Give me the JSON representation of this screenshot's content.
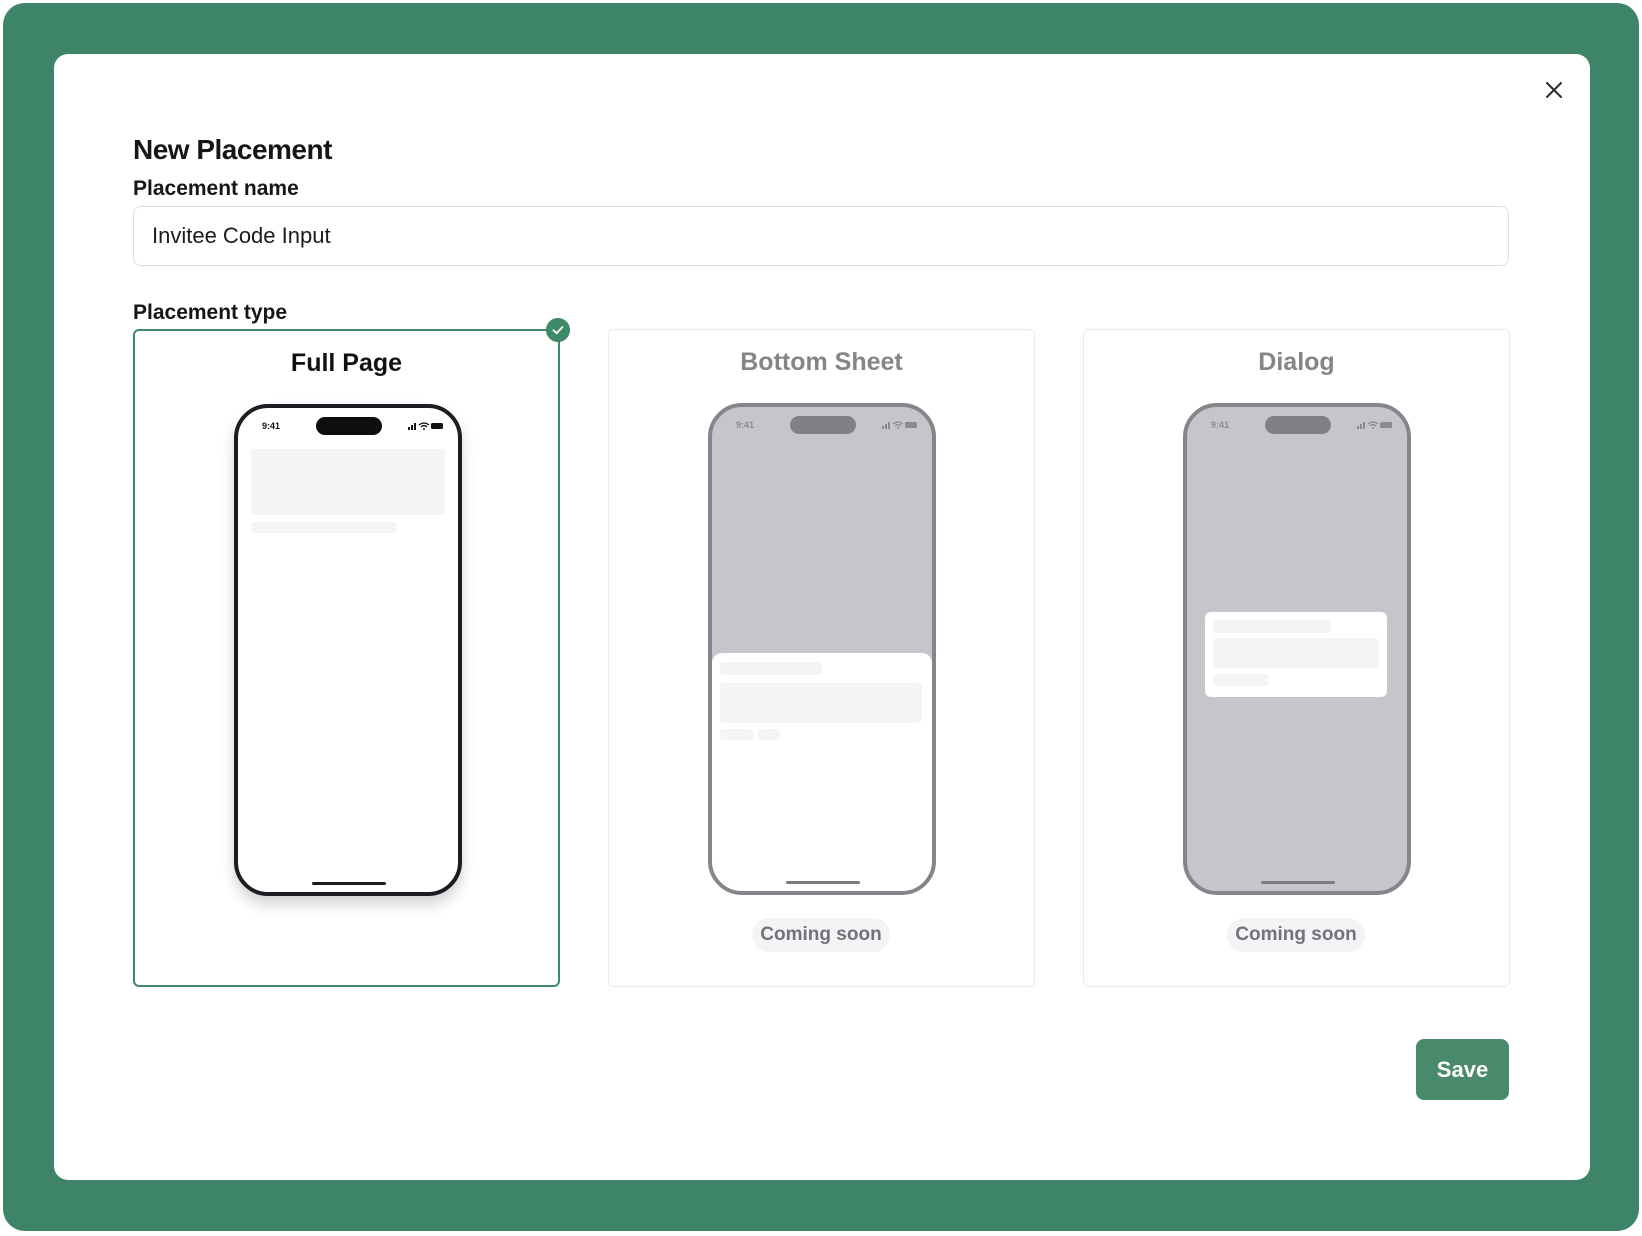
{
  "dialog": {
    "title": "New Placement",
    "name_label": "Placement name",
    "name_value": "Invitee Code Input",
    "type_label": "Placement type",
    "save_label": "Save"
  },
  "placement_types": [
    {
      "title": "Full Page",
      "selected": true,
      "badge": ""
    },
    {
      "title": "Bottom Sheet",
      "selected": false,
      "badge": "Coming soon"
    },
    {
      "title": "Dialog",
      "selected": false,
      "badge": "Coming soon"
    }
  ],
  "phone_status": {
    "time": "9:41"
  },
  "colors": {
    "background": "#3d8468",
    "accent": "#3f8a68",
    "save_button": "#4a8a6c",
    "disabled_text": "#848589"
  },
  "icons": {
    "close": "close-icon",
    "check": "check-icon",
    "signal": "cellular-signal-icon",
    "wifi": "wifi-icon",
    "battery": "battery-icon"
  }
}
